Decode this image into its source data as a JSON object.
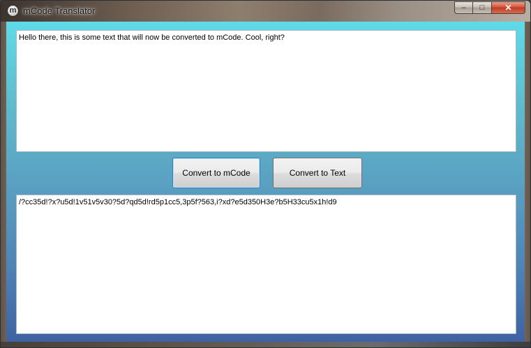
{
  "window": {
    "title": "mCode Translator",
    "icon_letter": "m",
    "caption_buttons": {
      "minimize": "–",
      "maximize": "□",
      "close": "✕"
    }
  },
  "input": {
    "value": "Hello there, this is some text that will now be converted to mCode. Cool, right?"
  },
  "buttons": {
    "convert_to_mcode": "Convert to mCode",
    "convert_to_text": "Convert to Text"
  },
  "output": {
    "value": "/?cc35d!?x?u5d!1v51v5v30?5d?qd5d!rd5p1cc5,3p5f?563,i?xd?e5d350H3e?b5H33cu5x1h!d9"
  },
  "colors": {
    "client_gradient_top": "#5fdbe9",
    "client_gradient_bottom": "#3f62a2",
    "focused_button_border": "#3c7fb1",
    "close_button": "#c13b23"
  }
}
